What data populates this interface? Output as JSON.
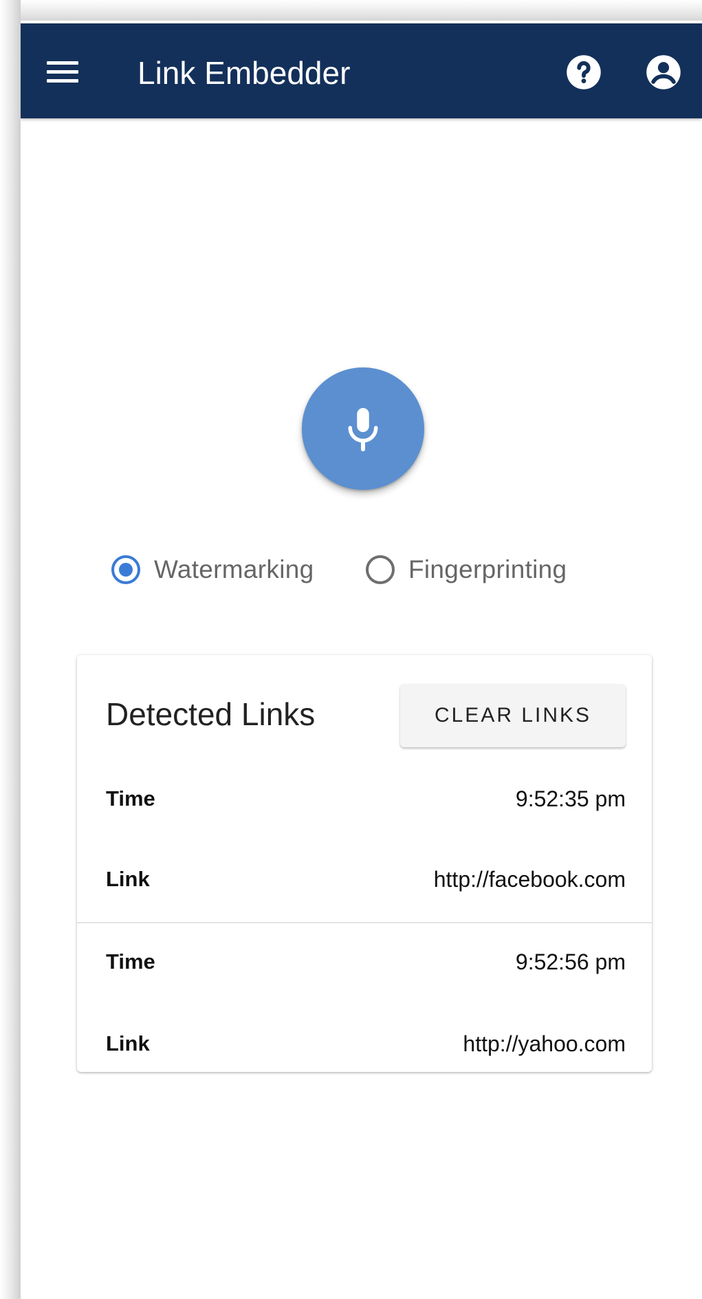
{
  "app_bar": {
    "title": "Link Embedder",
    "background_color": "#13305a",
    "menu_icon": "hamburger-menu-icon",
    "help_icon": "help-circle-icon",
    "account_icon": "account-circle-icon"
  },
  "mic_button": {
    "icon": "microphone-icon",
    "color": "#5b8fd0"
  },
  "detection_mode": {
    "options": [
      {
        "label": "Watermarking",
        "selected": true
      },
      {
        "label": "Fingerprinting",
        "selected": false
      }
    ],
    "accent_color": "#3a7bd5"
  },
  "links_card": {
    "title": "Detected Links",
    "clear_button_label": "CLEAR LINKS",
    "entries": [
      {
        "time_label": "Time",
        "time": "9:52:35 pm",
        "link_label": "Link",
        "link": "http://facebook.com"
      },
      {
        "time_label": "Time",
        "time": "9:52:56 pm",
        "link_label": "Link",
        "link": "http://yahoo.com"
      }
    ]
  }
}
